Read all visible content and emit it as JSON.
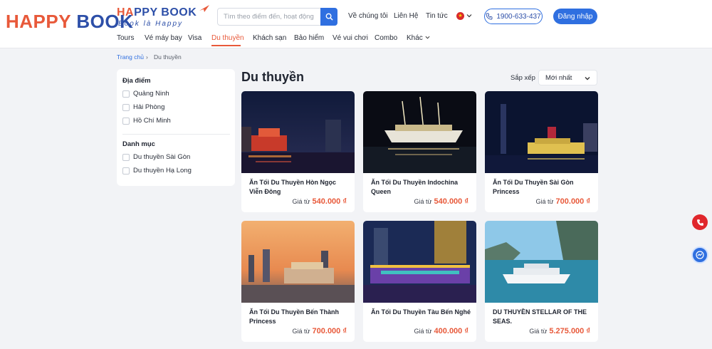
{
  "overlay_logo": {
    "part1": "HAPPY ",
    "part2": "BOOK"
  },
  "brand": {
    "word_a": "HA",
    "word_b": "PPY BOOK",
    "slogan": "Book là Happy"
  },
  "search": {
    "placeholder": "Tìm theo điểm đến, hoạt động"
  },
  "topnav": [
    "Về chúng tôi",
    "Liên Hệ",
    "Tin tức"
  ],
  "hotline": "1900-633-437",
  "login": "Đăng nhập",
  "mainnav": [
    "Tours",
    "Vé máy bay",
    "Visa",
    "Du thuyền",
    "Khách sạn",
    "Bảo hiểm",
    "Vé vui chơi",
    "Combo",
    "Khác"
  ],
  "breadcrumb": {
    "home": "Trang chủ",
    "sep": "›",
    "current": "Du thuyền"
  },
  "sidebar": {
    "location_title": "Địa điểm",
    "locations": [
      "Quảng Ninh",
      "Hải Phòng",
      "Hồ Chí Minh"
    ],
    "category_title": "Danh mục",
    "categories": [
      "Du thuyền Sài Gòn",
      "Du thuyền Hạ Long"
    ]
  },
  "page_title": "Du thuyền",
  "sort": {
    "label": "Sắp xếp",
    "value": "Mới nhất"
  },
  "price_prefix": "Giá từ",
  "cards": [
    {
      "name": "Ăn Tối Du Thuyền Hòn Ngọc Viễn Đông",
      "price": "540.000 ₫"
    },
    {
      "name": "Ăn Tối Du Thuyền Indochina Queen",
      "price": "540.000 ₫"
    },
    {
      "name": "Ăn Tối Du Thuyền Sài Gòn Princess",
      "price": "700.000 ₫"
    },
    {
      "name": "Ăn Tối Du Thuyền Bến Thành Princess",
      "price": "700.000 ₫"
    },
    {
      "name": "Ăn Tối Du Thuyền Tàu Bến Nghé",
      "price": "400.000 ₫"
    },
    {
      "name": "DU THUYỀN STELLAR OF THE SEAS.",
      "price": "5.275.000 ₫"
    }
  ],
  "colors": {
    "accent": "#e8593a",
    "primary": "#2f6fe0",
    "brand_blue": "#2d4fa8"
  }
}
